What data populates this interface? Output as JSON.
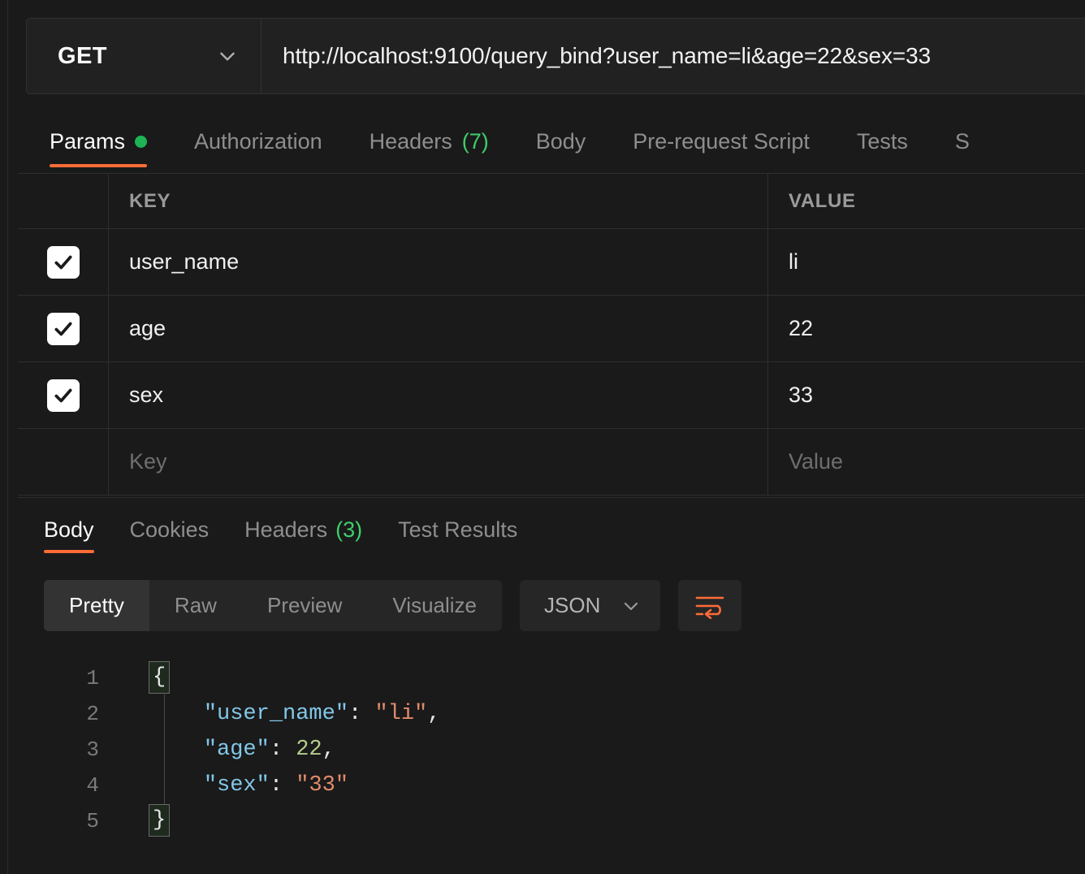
{
  "request": {
    "method": "GET",
    "method_chevron_icon": "chevron-down-icon",
    "url": "http://localhost:9100/query_bind?user_name=li&age=22&sex=33",
    "tabs": [
      {
        "label": "Params",
        "active": true,
        "dot": true
      },
      {
        "label": "Authorization",
        "active": false
      },
      {
        "label": "Headers",
        "count": "(7)",
        "active": false
      },
      {
        "label": "Body",
        "active": false
      },
      {
        "label": "Pre-request Script",
        "active": false
      },
      {
        "label": "Tests",
        "active": false
      },
      {
        "label": "S",
        "active": false
      }
    ]
  },
  "params": {
    "columns": {
      "check": "",
      "key": "KEY",
      "value": "VALUE"
    },
    "rows": [
      {
        "checked": true,
        "key": "user_name",
        "value": "li"
      },
      {
        "checked": true,
        "key": "age",
        "value": "22"
      },
      {
        "checked": true,
        "key": "sex",
        "value": "33"
      }
    ],
    "new_row": {
      "key_placeholder": "Key",
      "value_placeholder": "Value"
    }
  },
  "response": {
    "tabs": [
      {
        "label": "Body",
        "active": true
      },
      {
        "label": "Cookies",
        "active": false
      },
      {
        "label": "Headers",
        "count": "(3)",
        "active": false
      },
      {
        "label": "Test Results",
        "active": false
      }
    ],
    "view_modes": [
      {
        "label": "Pretty",
        "active": true
      },
      {
        "label": "Raw",
        "active": false
      },
      {
        "label": "Preview",
        "active": false
      },
      {
        "label": "Visualize",
        "active": false
      }
    ],
    "language": "JSON",
    "language_chevron_icon": "chevron-down-icon",
    "wrap_icon": "word-wrap-icon",
    "body_lines": [
      {
        "num": "1",
        "brace": "{",
        "text": ""
      },
      {
        "num": "2",
        "key": "\"user_name\"",
        "colon": ": ",
        "value": "\"li\"",
        "value_type": "string",
        "comma": ","
      },
      {
        "num": "3",
        "key": "\"age\"",
        "colon": ": ",
        "value": "22",
        "value_type": "number",
        "comma": ","
      },
      {
        "num": "4",
        "key": "\"sex\"",
        "colon": ": ",
        "value": "\"33\"",
        "value_type": "string",
        "comma": ""
      },
      {
        "num": "5",
        "brace": "}",
        "text": ""
      }
    ]
  },
  "colors": {
    "accent": "#ff6c37",
    "status_dot": "#1eb455",
    "count_green": "#3ecf6b",
    "background": "#1a1a1a",
    "json_key": "#82c7e8",
    "json_string": "#e08b6a",
    "json_number": "#b5cc8e"
  }
}
